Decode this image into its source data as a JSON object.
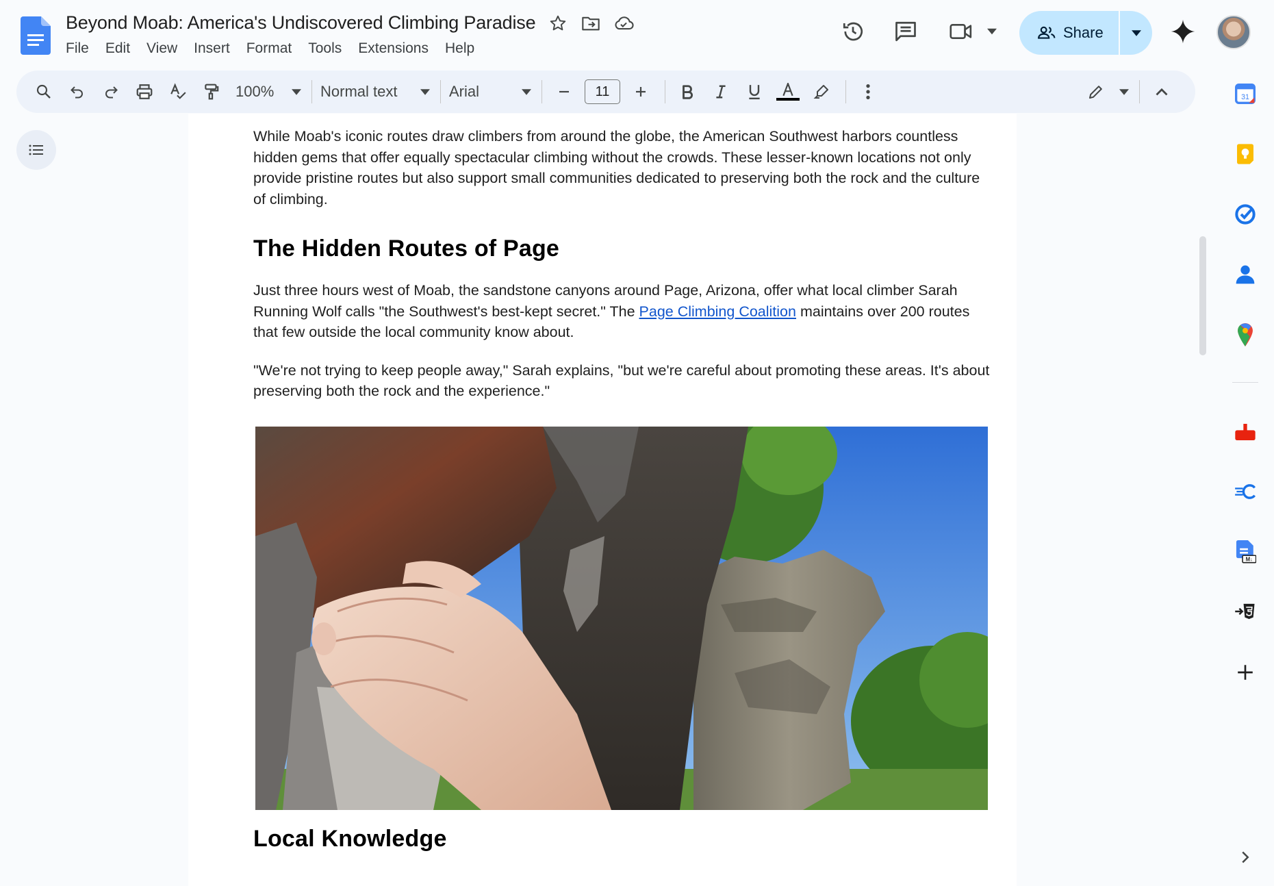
{
  "app": {
    "doc_title": "Beyond Moab: America's Undiscovered Climbing Paradise"
  },
  "menu": [
    "File",
    "Edit",
    "View",
    "Insert",
    "Format",
    "Tools",
    "Extensions",
    "Help"
  ],
  "header": {
    "share_label": "Share"
  },
  "toolbar": {
    "zoom": "100%",
    "style": "Normal text",
    "font": "Arial",
    "font_size": "11",
    "text_color": "#000000"
  },
  "document": {
    "intro": "While Moab's iconic routes draw climbers from around the globe, the American Southwest harbors countless hidden gems that offer equally spectacular climbing without the crowds. These lesser-known locations not only provide pristine routes but also support small communities dedicated to preserving both the rock and the culture of climbing.",
    "heading1": "The Hidden Routes of Page",
    "para2_before": "Just three hours west of Moab, the sandstone canyons around Page, Arizona, offer what local climber Sarah Running Wolf calls \"the Southwest's best-kept secret.\" The ",
    "para2_link": "Page Climbing Coalition",
    "para2_after": " maintains over 200 routes that few outside the local community know about.",
    "quote": "\"We're not trying to keep people away,\" Sarah explains, \"but we're careful about promoting these areas. It's about preserving both the rock and the experience.\"",
    "heading2": "Local Knowledge"
  },
  "icons": {
    "side_panel": [
      "calendar-icon",
      "keep-icon",
      "tasks-icon",
      "contacts-icon",
      "maps-icon",
      "addon-red-icon",
      "addon-c-icon",
      "addon-markdown-icon",
      "addon-html-icon",
      "add-addon-icon"
    ]
  },
  "colors": {
    "share_bg": "#c2e7ff",
    "toolbar_bg": "#edf2fa",
    "link": "#1155cc",
    "docs_blue": "#4285f4"
  }
}
